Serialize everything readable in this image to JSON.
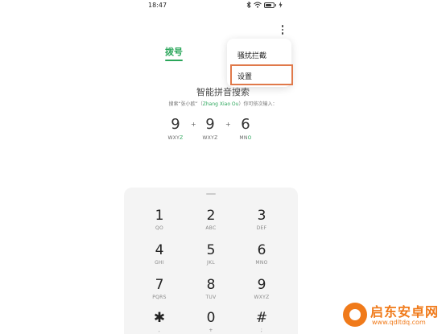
{
  "status_bar": {
    "time": "18:47",
    "icons": [
      "bluetooth-icon",
      "wifi-icon",
      "battery-icon",
      "charging-icon"
    ]
  },
  "header": {
    "tab_dial": "拨号",
    "more_icon": "more-vertical-icon"
  },
  "overflow_menu": {
    "items": [
      {
        "label": "骚扰拦截"
      },
      {
        "label": "设置",
        "highlighted": true
      }
    ]
  },
  "smart_search": {
    "title": "智能拼音搜索",
    "hint_prefix": "搜索“张小欧”（",
    "hint_pinyin": "Zhang Xiao Ou",
    "hint_suffix": "）你可依次输入："
  },
  "example_keys": [
    {
      "digit": "9",
      "letters": "WXY",
      "accent": "Z"
    },
    {
      "digit": "9",
      "letters": "WXYZ",
      "accent": ""
    },
    {
      "digit": "6",
      "letters": "MN",
      "accent": "O"
    }
  ],
  "example_separator": "+",
  "keypad": {
    "keys": [
      {
        "digit": "1",
        "letters": "QO"
      },
      {
        "digit": "2",
        "letters": "ABC"
      },
      {
        "digit": "3",
        "letters": "DEF"
      },
      {
        "digit": "4",
        "letters": "GHI"
      },
      {
        "digit": "5",
        "letters": "JKL"
      },
      {
        "digit": "6",
        "letters": "MNO"
      },
      {
        "digit": "7",
        "letters": "PQRS"
      },
      {
        "digit": "8",
        "letters": "TUV"
      },
      {
        "digit": "9",
        "letters": "WXYZ"
      },
      {
        "digit": "✱",
        "letters": ","
      },
      {
        "digit": "0",
        "letters": "+"
      },
      {
        "digit": "#",
        "letters": ";"
      }
    ]
  },
  "watermark": {
    "name": "启东安卓网",
    "url": "www.qdltdq.com"
  },
  "colors": {
    "accent_green": "#2aa65a",
    "highlight_orange": "#e0794a",
    "watermark_orange": "#f07a1a"
  }
}
